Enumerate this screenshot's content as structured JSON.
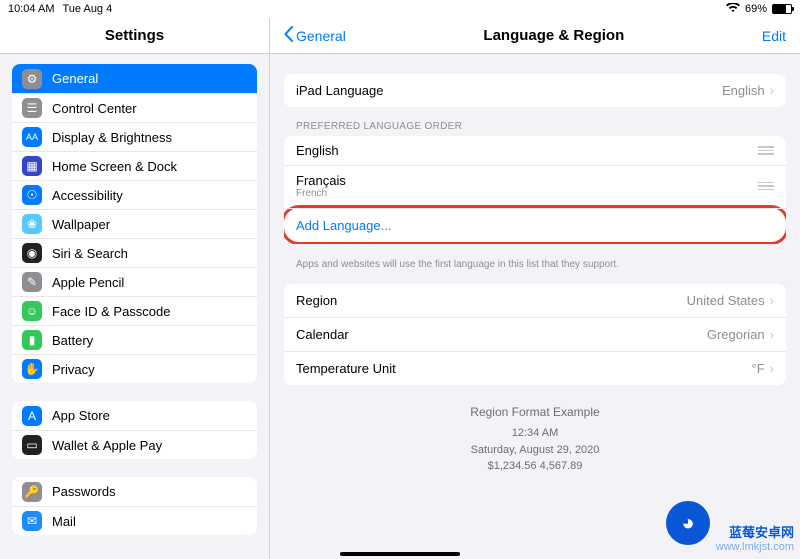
{
  "status": {
    "time": "10:04 AM",
    "date": "Tue Aug 4",
    "battery_pct": "69%"
  },
  "sidebar": {
    "title": "Settings",
    "groups": [
      {
        "items": [
          {
            "icon": "gear-icon",
            "label": "General",
            "selected": true
          },
          {
            "icon": "controlcenter-icon",
            "label": "Control Center"
          },
          {
            "icon": "display-icon",
            "label": "Display & Brightness"
          },
          {
            "icon": "homescreen-icon",
            "label": "Home Screen & Dock"
          },
          {
            "icon": "accessibility-icon",
            "label": "Accessibility"
          },
          {
            "icon": "wallpaper-icon",
            "label": "Wallpaper"
          },
          {
            "icon": "siri-icon",
            "label": "Siri & Search"
          },
          {
            "icon": "pencil-icon",
            "label": "Apple Pencil"
          },
          {
            "icon": "faceid-icon",
            "label": "Face ID & Passcode"
          },
          {
            "icon": "battery-icon",
            "label": "Battery"
          },
          {
            "icon": "privacy-icon",
            "label": "Privacy"
          }
        ]
      },
      {
        "items": [
          {
            "icon": "appstore-icon",
            "label": "App Store"
          },
          {
            "icon": "wallet-icon",
            "label": "Wallet & Apple Pay"
          }
        ]
      },
      {
        "items": [
          {
            "icon": "passwords-icon",
            "label": "Passwords"
          },
          {
            "icon": "mail-icon",
            "label": "Mail"
          }
        ]
      }
    ]
  },
  "detail": {
    "back_label": "General",
    "title": "Language & Region",
    "edit_label": "Edit",
    "ipad_lang_label": "iPad Language",
    "ipad_lang_value": "English",
    "pref_order_header": "PREFERRED LANGUAGE ORDER",
    "languages": [
      {
        "name": "English",
        "native": ""
      },
      {
        "name": "Français",
        "native": "French"
      }
    ],
    "add_language": "Add Language...",
    "footer_note": "Apps and websites will use the first language in this list that they support.",
    "region_label": "Region",
    "region_value": "United States",
    "calendar_label": "Calendar",
    "calendar_value": "Gregorian",
    "temp_label": "Temperature Unit",
    "temp_value": "°F",
    "example": {
      "title": "Region Format Example",
      "time": "12:34 AM",
      "date": "Saturday, August 29, 2020",
      "numbers": "$1,234.56      4,567.89"
    }
  },
  "watermark": {
    "text": "蓝莓安卓网",
    "url": "www.lmkjst.com"
  }
}
